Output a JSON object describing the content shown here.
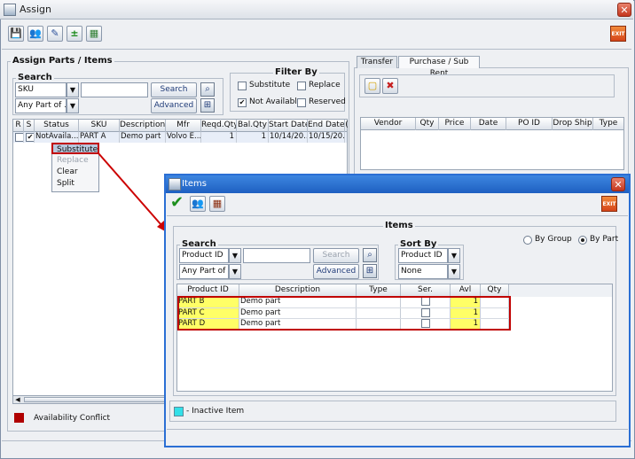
{
  "window": {
    "title": "Assign",
    "close": "✕"
  },
  "toolbar": {
    "save": "💾",
    "people": "👥",
    "edit": "✎",
    "add_remove": "±",
    "chart": "▦",
    "exit": "EXIT"
  },
  "assign_parts": {
    "legend": "Assign Parts / Items",
    "search": {
      "legend": "Search",
      "field_value": "SKU",
      "match_value": "Any Part of ...",
      "input_value": "",
      "search_button": "Search",
      "advanced_button": "Advanced"
    },
    "filter": {
      "legend": "Filter By",
      "substitute": "Substitute",
      "replace": "Replace",
      "not_available": "Not Available",
      "reserved": "Reserved",
      "not_available_checked": "✔"
    },
    "columns": [
      "R",
      "S",
      "Status",
      "SKU",
      "Description",
      "Mfr",
      "Reqd.Qty",
      "Bal.Qty",
      "Start Date",
      "End Date",
      "("
    ],
    "rows": [
      {
        "r": "",
        "s": "✔",
        "status": "NotAvaila...",
        "sku": "PART A",
        "description": "Demo part",
        "mfr": "Volvo E...",
        "reqd": "1",
        "bal": "1",
        "start": "10/14/20...",
        "end": "10/15/20..."
      }
    ],
    "context_menu": [
      "Substitute",
      "Replace",
      "Clear",
      "Split"
    ],
    "legend_conflict": "Availability Conflict"
  },
  "right_panel": {
    "tabs": [
      "Transfer",
      "Purchase / Sub Rent"
    ],
    "columns": [
      "Vendor",
      "Qty",
      "Price",
      "Date",
      "PO ID",
      "Drop Ship",
      "Type"
    ]
  },
  "items_dialog": {
    "title": "Items",
    "close": "✕",
    "exit": "EXIT",
    "group_legend": "Items",
    "search": {
      "legend": "Search",
      "field_value": "Product ID",
      "match_value": "Any Part of ...",
      "input_value": "",
      "search_button": "Search",
      "advanced_button": "Advanced"
    },
    "sort": {
      "legend": "Sort By",
      "field_value": "Product ID",
      "order_value": "None"
    },
    "view": {
      "by_group": "By Group",
      "by_part": "By Part"
    },
    "columns": [
      "Product ID",
      "Description",
      "Type",
      "Ser.",
      "Avl",
      "Qty"
    ],
    "rows": [
      {
        "id": "PART B",
        "description": "Demo part",
        "type": "",
        "avl": "1",
        "qty": ""
      },
      {
        "id": "PART C",
        "description": "Demo part",
        "type": "",
        "avl": "1",
        "qty": ""
      },
      {
        "id": "PART D",
        "description": "Demo part",
        "type": "",
        "avl": "1",
        "qty": ""
      }
    ],
    "inactive_legend": "- Inactive Item"
  },
  "colors": {
    "highlight_red": "#c00000",
    "yellow": "#ffff66",
    "inactive_cyan": "#33e0e8",
    "conflict_red": "#b00000"
  }
}
